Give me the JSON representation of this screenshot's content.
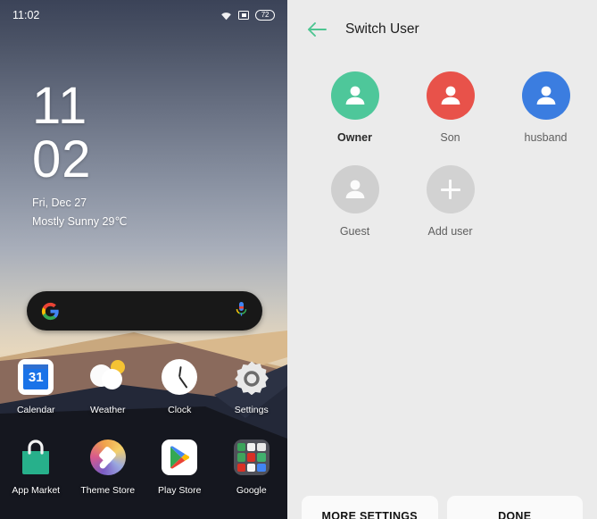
{
  "home": {
    "statusbar": {
      "time": "11:02",
      "wifi_icon": "wifi-icon",
      "cast_icon": "screen-cast-icon",
      "battery_level": "72",
      "battery_icon": "battery-icon"
    },
    "clock_widget": {
      "hour": "11",
      "minute": "02",
      "date": "Fri, Dec 27",
      "weather": "Mostly Sunny 29℃"
    },
    "search_bar": {
      "google_icon": "google-g-icon",
      "mic_icon": "microphone-icon",
      "placeholder": ""
    },
    "apps_row1": [
      {
        "label": "Calendar",
        "icon": "calendar-icon",
        "day": "31"
      },
      {
        "label": "Weather",
        "icon": "weather-icon"
      },
      {
        "label": "Clock",
        "icon": "clock-icon"
      },
      {
        "label": "Settings",
        "icon": "settings-gear-icon"
      }
    ],
    "apps_row2": [
      {
        "label": "App Market",
        "icon": "app-market-icon"
      },
      {
        "label": "Theme Store",
        "icon": "theme-store-icon"
      },
      {
        "label": "Play Store",
        "icon": "play-store-icon"
      },
      {
        "label": "Google",
        "icon": "google-folder-icon"
      }
    ]
  },
  "switch_user": {
    "back_icon": "back-arrow-icon",
    "title": "Switch User",
    "accent_color": "#4dc591",
    "users_row1": [
      {
        "name": "Owner",
        "color": "#4ec79a",
        "icon": "person-icon",
        "current": true
      },
      {
        "name": "Son",
        "color": "#e8524a",
        "icon": "person-icon",
        "current": false
      },
      {
        "name": "husband",
        "color": "#3b7de0",
        "icon": "person-icon",
        "current": false
      }
    ],
    "users_row2": [
      {
        "name": "Guest",
        "color": "#cfcfcf",
        "icon": "person-icon"
      },
      {
        "name": "Add user",
        "color": "#d2d2d2",
        "icon": "plus-icon"
      }
    ],
    "footer": {
      "more_settings_label": "MORE SETTINGS",
      "done_label": "DONE"
    }
  }
}
